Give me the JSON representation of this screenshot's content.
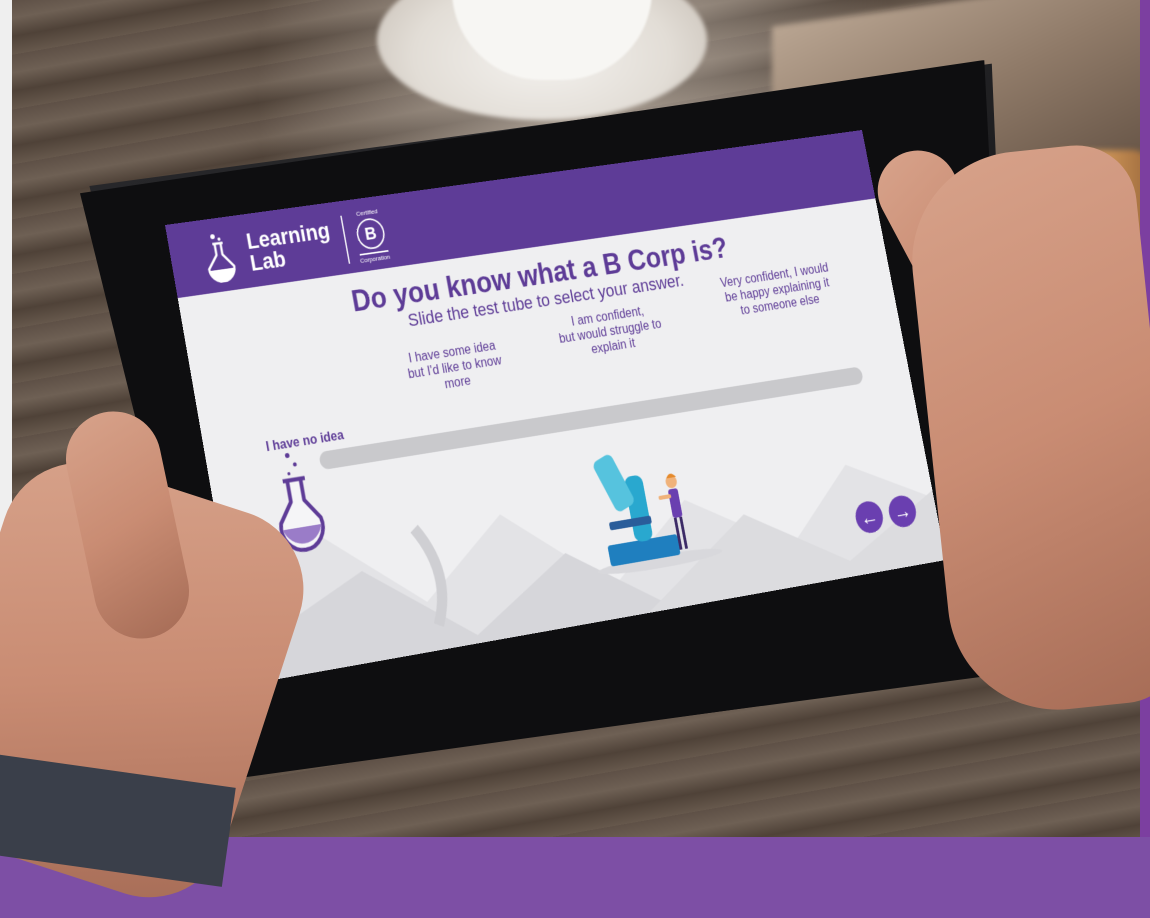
{
  "app": {
    "logo_line1": "Learning",
    "logo_line2": "Lab",
    "badge_top": "Certified",
    "badge_letter": "B",
    "badge_bottom": "Corporation"
  },
  "question": {
    "title": "Do you know what a B Corp is?",
    "subtitle": "Slide the test tube to select your answer."
  },
  "slider": {
    "options": [
      {
        "label": "I have no idea"
      },
      {
        "label_lines": [
          "I have some idea",
          "but I'd like to know",
          "more"
        ]
      },
      {
        "label_lines": [
          "I am confident,",
          "but would struggle to",
          "explain it"
        ]
      },
      {
        "label_lines": [
          "Very confident, I would",
          "be happy explaining it",
          "to someone else"
        ]
      }
    ],
    "selected_index": 0
  },
  "nav": {
    "back_icon": "←",
    "next_icon": "→"
  },
  "colors": {
    "brand": "#5e3c97",
    "button": "#6a3fb0",
    "screen_bg": "#efeff1",
    "track": "#c9c9cc"
  }
}
